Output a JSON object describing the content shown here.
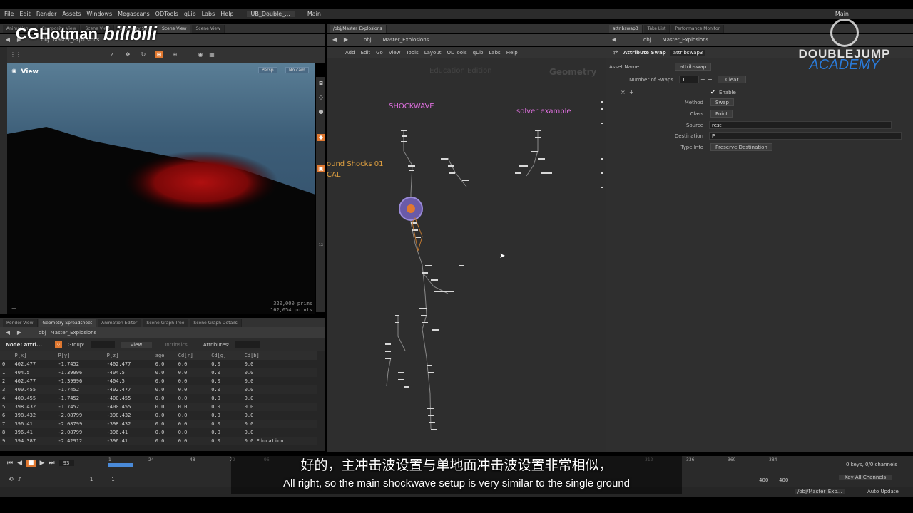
{
  "menubar": [
    "File",
    "Edit",
    "Render",
    "Assets",
    "Windows",
    "Megascans",
    "ODTools",
    "qLib",
    "Labs",
    "Help"
  ],
  "desktop_tab": "UB_Double_...",
  "desktop_main": "Main",
  "desktop_main_right": "Main",
  "watermark": {
    "left": "CGHotman",
    "left_logo": "bilibili",
    "right_top": "DOUBLEJUMP",
    "right_bottom": "ACADEMY"
  },
  "left_tabs": [
    "Animation...",
    "Composite View",
    "Scene View",
    "Geometry Spr...",
    "Scene View",
    "Scene View"
  ],
  "left_path": [
    "obj",
    "Master_Explosions"
  ],
  "viewport": {
    "title": "View",
    "persp": "Persp",
    "cam": "No cam",
    "prims": "320,000 prims",
    "points": "162,054 points"
  },
  "sheet_tabs": [
    "Render View",
    "Geometry Spreadsheet",
    "Animation Editor",
    "Scene Graph Tree",
    "Scene Graph Details"
  ],
  "sheet_path": [
    "obj",
    "Master_Explosions"
  ],
  "sheet_filters": {
    "node": "Node: attri...",
    "group": "Group:",
    "view": "View",
    "intrinsics": "Intrinsics",
    "attributes": "Attributes:"
  },
  "sheet_columns": [
    "",
    "P[x]",
    "P[y]",
    "P[z]",
    "age",
    "Cd[r]",
    "Cd[g]",
    "Cd[b]"
  ],
  "sheet_rows": [
    [
      "0",
      "402.477",
      "-1.7452",
      "-402.477",
      "0.0",
      "0.0",
      "0.0",
      "0.0"
    ],
    [
      "1",
      "404.5",
      "-1.39996",
      "-404.5",
      "0.0",
      "0.0",
      "0.0",
      "0.0"
    ],
    [
      "2",
      "402.477",
      "-1.39996",
      "-404.5",
      "0.0",
      "0.0",
      "0.0",
      "0.0"
    ],
    [
      "3",
      "400.455",
      "-1.7452",
      "-402.477",
      "0.0",
      "0.0",
      "0.0",
      "0.0"
    ],
    [
      "4",
      "400.455",
      "-1.7452",
      "-400.455",
      "0.0",
      "0.0",
      "0.0",
      "0.0"
    ],
    [
      "5",
      "398.432",
      "-1.7452",
      "-400.455",
      "0.0",
      "0.0",
      "0.0",
      "0.0"
    ],
    [
      "6",
      "398.432",
      "-2.08799",
      "-398.432",
      "0.0",
      "0.0",
      "0.0",
      "0.0"
    ],
    [
      "7",
      "396.41",
      "-2.08799",
      "-398.432",
      "0.0",
      "0.0",
      "0.0",
      "0.0"
    ],
    [
      "8",
      "396.41",
      "-2.08799",
      "-396.41",
      "0.0",
      "0.0",
      "0.0",
      "0.0"
    ],
    [
      "9",
      "394.387",
      "-2.42912",
      "-396.41",
      "0.0",
      "0.0",
      "0.0",
      "0.0 Education"
    ]
  ],
  "network_tabs": [
    "/obj/Master_Explosions"
  ],
  "network_path": [
    "obj",
    "Master_Explosions"
  ],
  "network_menu": [
    "Add",
    "Edit",
    "Go",
    "View",
    "Tools",
    "Layout",
    "ODTools",
    "qLib",
    "Labs",
    "Help"
  ],
  "network": {
    "edition": "Education Edition",
    "context": "Geometry",
    "label_shockwave": "SHOCKWAVE",
    "label_solver": "solver example",
    "label_ground": "ound Shocks 01",
    "label_local": "CAL"
  },
  "params_tabs": [
    "attribswap3",
    "Take List",
    "Performance Monitor"
  ],
  "params_path": [
    "obj",
    "Master_Explosions"
  ],
  "params": {
    "node_type": "Attribute Swap",
    "node_name": "attribswap3",
    "asset_name_label": "Asset Name",
    "asset_name_value": "attribswap",
    "num_swaps_label": "Number of Swaps",
    "num_swaps_value": "1",
    "clear": "Clear",
    "enable": "Enable",
    "method_label": "Method",
    "method_value": "Swap",
    "class_label": "Class",
    "class_value": "Point",
    "source_label": "Source",
    "source_value": "rest",
    "dest_label": "Destination",
    "dest_value": "P",
    "typeinfo_label": "Type Info",
    "typeinfo_value": "Preserve Destination"
  },
  "timeline": {
    "frame": "93",
    "ticks": [
      "1",
      "24",
      "48",
      "72",
      "96",
      "312",
      "336",
      "360",
      "384"
    ],
    "start": "1",
    "start2": "1",
    "end": "400",
    "end2": "400",
    "keys": "0 keys, 0/0 channels",
    "key_all": "Key All Channels",
    "status_path": "/obj/Master_Exp...",
    "auto_update": "Auto Update"
  },
  "subtitle": {
    "cn": "好的，主冲击波设置与单地面冲击波设置非常相似，",
    "en": "All right, so the main shockwave setup is very similar to the single ground"
  },
  "colors": {
    "accent_orange": "#e0a040",
    "label_magenta": "#e070e0",
    "selection": "#e07830"
  }
}
